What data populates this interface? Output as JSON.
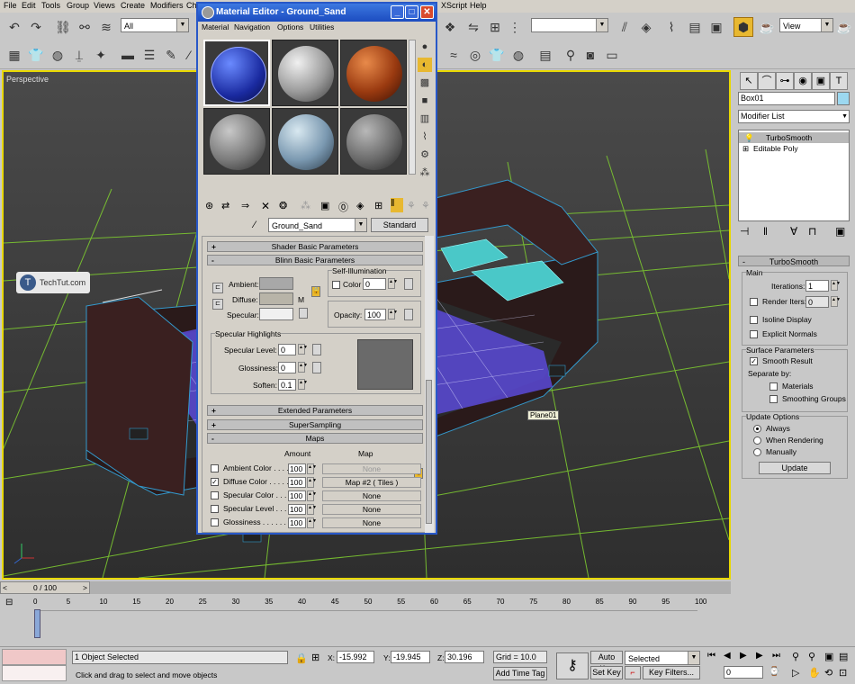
{
  "main_menu": [
    "File",
    "Edit",
    "Tools",
    "Group",
    "Views",
    "Create",
    "Modifiers",
    "Ch",
    "XScript",
    "Help"
  ],
  "toolbar": {
    "filter_value": "All",
    "view_value": "View"
  },
  "viewport": {
    "label": "Perspective",
    "object_tooltip": "Plane01"
  },
  "watermark": "TechTut.com",
  "command_panel": {
    "object_name": "Box01",
    "modifier_list": "Modifier List",
    "stack": [
      "TurboSmooth",
      "Editable Poly"
    ],
    "turbosmooth": {
      "title": "TurboSmooth",
      "main": "Main",
      "iterations_label": "Iterations:",
      "iterations": "1",
      "render_iters_label": "Render Iters:",
      "render_iters": "0",
      "isoline": "Isoline Display",
      "explicit_normals": "Explicit Normals",
      "surface_params": "Surface Parameters",
      "smooth_result": "Smooth Result",
      "separate_by": "Separate by:",
      "materials": "Materials",
      "smoothing_groups": "Smoothing Groups",
      "update_options": "Update Options",
      "always": "Always",
      "when_rendering": "When Rendering",
      "manually": "Manually",
      "update_button": "Update"
    }
  },
  "timeline": {
    "frame_counter": "0 / 100",
    "ticks": [
      "0",
      "5",
      "10",
      "15",
      "20",
      "25",
      "30",
      "35",
      "40",
      "45",
      "50",
      "55",
      "60",
      "65",
      "70",
      "75",
      "80",
      "85",
      "90",
      "95",
      "100"
    ]
  },
  "status": {
    "selection": "1 Object Selected",
    "prompt": "Click and drag to select and move objects",
    "x_label": "X:",
    "x": "-15.992",
    "y_label": "Y:",
    "y": "-19.945",
    "z_label": "Z:",
    "z": "30.196",
    "grid": "Grid = 10.0",
    "add_time_tag": "Add Time Tag",
    "auto_key": "Auto Key",
    "set_key": "Set Key",
    "selected": "Selected",
    "key_filters": "Key Filters...",
    "frame": "0"
  },
  "material_editor": {
    "title": "Material Editor - Ground_Sand",
    "menu": [
      "Material",
      "Navigation",
      "Options",
      "Utilities"
    ],
    "material_name": "Ground_Sand",
    "material_type": "Standard",
    "rollouts": {
      "shader_basic": "Shader Basic Parameters",
      "blinn_basic": "Blinn Basic Parameters",
      "extended": "Extended Parameters",
      "supersampling": "SuperSampling",
      "maps": "Maps"
    },
    "blinn": {
      "ambient": "Ambient:",
      "diffuse": "Diffuse:",
      "specular": "Specular:",
      "m_button": "M",
      "self_illum": "Self-Illumination",
      "color_label": "Color",
      "color_value": "0",
      "opacity_label": "Opacity:",
      "opacity_value": "100",
      "spec_highlights": "Specular Highlights",
      "spec_level_label": "Specular Level:",
      "spec_level": "0",
      "glossiness_label": "Glossiness:",
      "glossiness": "0",
      "soften_label": "Soften:",
      "soften": "0.1"
    },
    "maps": {
      "amount_header": "Amount",
      "map_header": "Map",
      "rows": [
        {
          "label": "Ambient Color . . . . .",
          "amount": "100",
          "map": "None",
          "checked": false
        },
        {
          "label": "Diffuse Color . . . . .",
          "amount": "100",
          "map": "Map #2  ( Tiles )",
          "checked": true
        },
        {
          "label": "Specular Color . . . .",
          "amount": "100",
          "map": "None",
          "checked": false
        },
        {
          "label": "Specular Level . . .",
          "amount": "100",
          "map": "None",
          "checked": false
        },
        {
          "label": "Glossiness . . . . . .",
          "amount": "100",
          "map": "None",
          "checked": false
        }
      ]
    }
  }
}
